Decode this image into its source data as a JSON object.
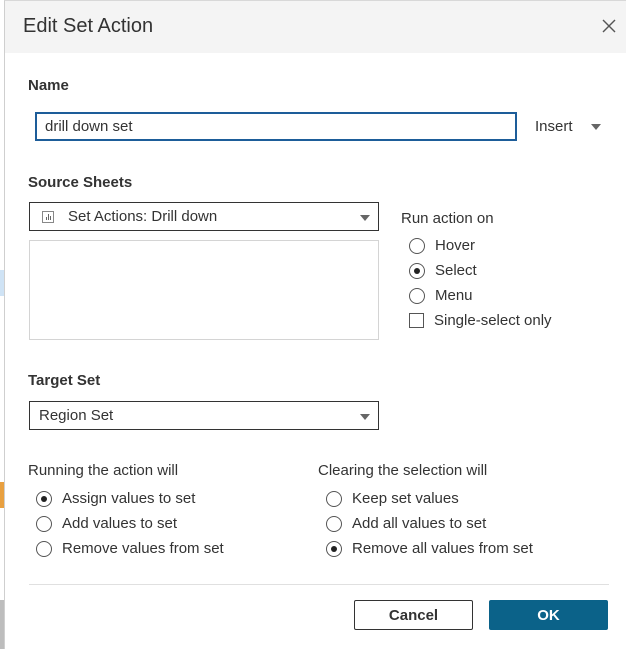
{
  "dialog": {
    "title": "Edit Set Action",
    "close_icon": "close-icon"
  },
  "name_section": {
    "label": "Name",
    "value": "drill down set",
    "insert_label": "Insert"
  },
  "source_sheets": {
    "label": "Source Sheets",
    "selected": "Set Actions: Drill down",
    "icon": "bar-chart-sheet-icon",
    "sheets_list": []
  },
  "run_action_on": {
    "label": "Run action on",
    "options": [
      {
        "label": "Hover",
        "selected": false
      },
      {
        "label": "Select",
        "selected": true
      },
      {
        "label": "Menu",
        "selected": false
      }
    ],
    "single_select": {
      "label": "Single-select only",
      "checked": false
    }
  },
  "target_set": {
    "label": "Target Set",
    "selected": "Region Set"
  },
  "running_action": {
    "label": "Running the action will",
    "options": [
      {
        "label": "Assign values to set",
        "selected": true
      },
      {
        "label": "Add values to set",
        "selected": false
      },
      {
        "label": "Remove values from set",
        "selected": false
      }
    ]
  },
  "clearing_selection": {
    "label": "Clearing the selection will",
    "options": [
      {
        "label": "Keep set values",
        "selected": false
      },
      {
        "label": "Add all values to set",
        "selected": false
      },
      {
        "label": "Remove all values from set",
        "selected": true
      }
    ]
  },
  "footer": {
    "cancel_label": "Cancel",
    "ok_label": "OK"
  },
  "colors": {
    "accent": "#0b6289",
    "focus_border": "#1d5d99",
    "title_bar": "#f4f4f4"
  }
}
